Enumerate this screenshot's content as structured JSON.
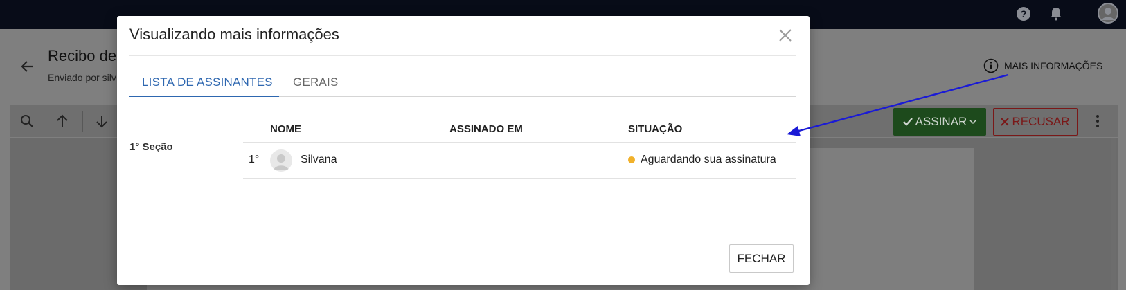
{
  "background": {
    "doc_title": "Recibo de",
    "doc_subtitle": "Enviado por silv",
    "more_info_label": "MAIS INFORMAÇÕES",
    "sign_button_label": "ASSINAR",
    "refuse_button_label": "RECUSAR"
  },
  "modal": {
    "title": "Visualizando mais informações",
    "tabs": [
      {
        "label": "LISTA DE ASSINANTES",
        "active": true
      },
      {
        "label": "GERAIS",
        "active": false
      }
    ],
    "section_label": "1° Seção",
    "columns": [
      "NOME",
      "ASSINADO EM",
      "SITUAÇÃO"
    ],
    "rows": [
      {
        "order": "1°",
        "name": "Silvana",
        "signed_at": "",
        "status": "Aguardando sua assinatura"
      }
    ],
    "close_button_label": "FECHAR"
  },
  "colors": {
    "accent_blue": "#2e67b0",
    "status_pending": "#f1b12b",
    "annotation_arrow": "#1a1ad6",
    "sign_green": "#1d4a1c",
    "refuse_red": "#7a1818"
  },
  "icons": [
    "help-icon",
    "bell-icon",
    "user-avatar-icon",
    "back-arrow-icon",
    "info-icon",
    "search-icon",
    "arrow-up-icon",
    "arrow-down-icon",
    "check-icon",
    "chevron-down-icon",
    "x-icon",
    "kebab-menu-icon",
    "close-icon",
    "avatar-placeholder-icon"
  ]
}
